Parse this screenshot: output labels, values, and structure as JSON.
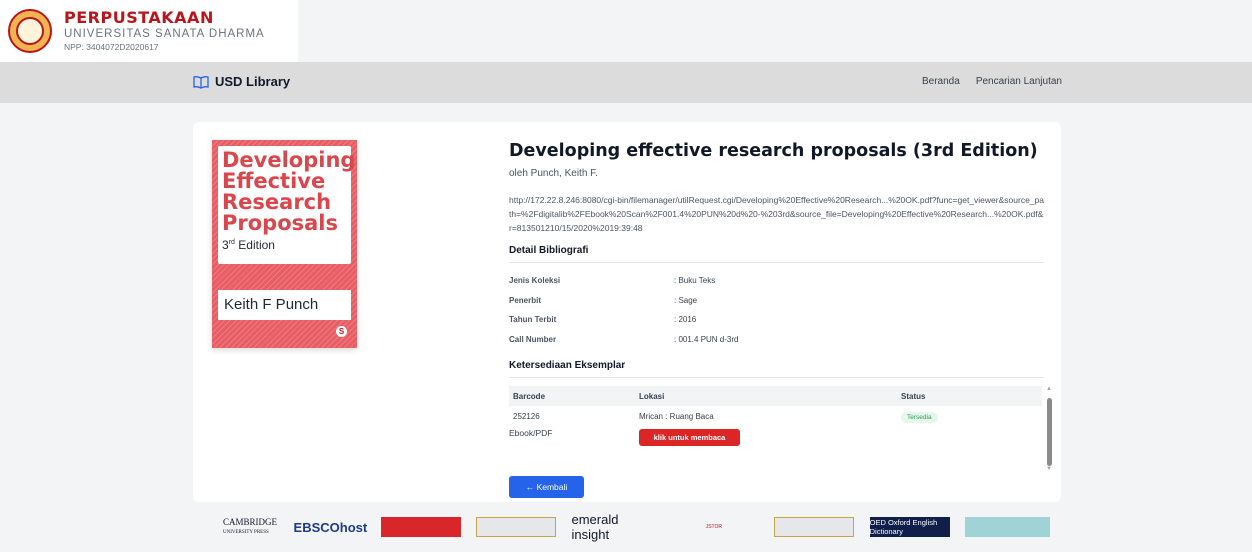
{
  "brand": {
    "title": "PERPUSTAKAAN",
    "subtitle": "UNIVERSITAS SANATA DHARMA",
    "npp": "NPP: 3404072D2020617"
  },
  "navbar": {
    "brand_label": "USD Library",
    "links": [
      "Beranda",
      "Pencarian Lanjutan"
    ]
  },
  "cover": {
    "title": "Developing Effective Research Proposals",
    "edition_num": "3",
    "edition_sup": "rd",
    "edition_word": "Edition",
    "author": "Keith F Punch",
    "publisher_mark": "S"
  },
  "book": {
    "title": "Developing effective research proposals (3rd Edition)",
    "author_line": "oleh Punch, Keith F.",
    "url": "http://172.22.8.246:8080/cgi-bin/filemanager/utilRequest.cgi/Developing%20Effective%20Research...%20OK.pdf?func=get_viewer&source_path=%2Fdigitalib%2FEbook%20Scan%2F001.4%20PUN%20d%20-%203rd&source_file=Developing%20Effective%20Research...%20OK.pdf&r=813501210/15/2020%2019:39:48"
  },
  "biblio": {
    "heading": "Detail Bibliografi",
    "rows": [
      {
        "key": "Jenis Koleksi",
        "value": ": Buku Teks"
      },
      {
        "key": "Penerbit",
        "value": ": Sage"
      },
      {
        "key": "Tahun Terbit",
        "value": ": 2016"
      },
      {
        "key": "Call Number",
        "value": ": 001.4 PUN d-3rd"
      }
    ]
  },
  "availability": {
    "heading": "Ketersediaan Eksemplar",
    "columns": [
      "Barcode",
      "Lokasi",
      "Status"
    ],
    "rows": [
      {
        "barcode": "252126",
        "location": "Mrican : Ruang Baca",
        "status": "Tersedia"
      }
    ],
    "ebook_label": "Ebook/PDF",
    "read_button": "klik untuk membaca",
    "status_color": "#2d9a4f"
  },
  "back_button": "← Kembali",
  "partners": {
    "cambridge": "CAMBRIDGE",
    "cambridge_sub": "UNIVERSITY PRESS",
    "ebsco": "EBSCOhost",
    "emerald": "emerald insight",
    "jstor": "JSTOR",
    "oed": "OED  Oxford English Dictionary"
  },
  "colors": {
    "brand_red": "#b8151d",
    "button_blue": "#2563eb",
    "button_red": "#dc2626"
  }
}
